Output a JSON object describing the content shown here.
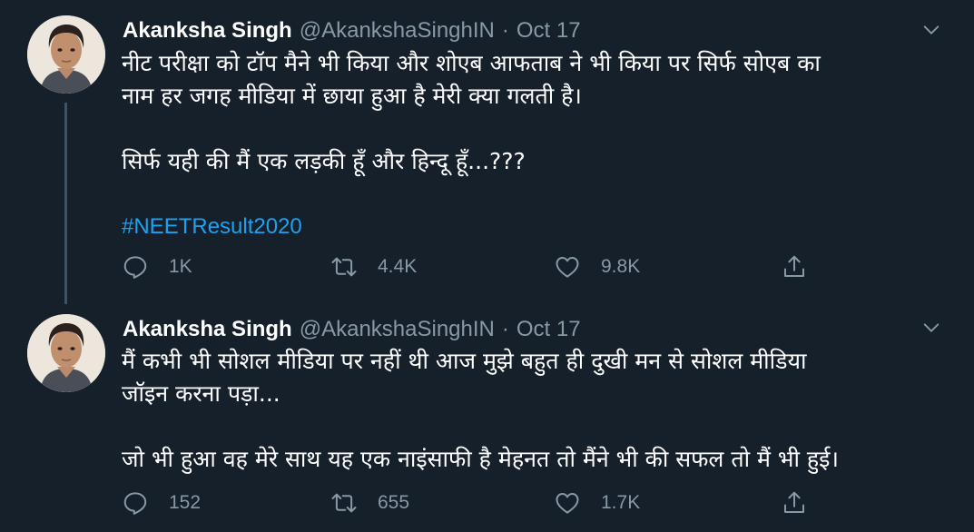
{
  "colors": {
    "background": "#15202b",
    "text": "#ffffff",
    "muted": "#8899a6",
    "hashtag": "#1da1f2",
    "thread_line": "#3d5466"
  },
  "tweets": [
    {
      "author_name": "Akanksha Singh",
      "handle": "@AkankshaSinghIN",
      "separator": "·",
      "date": "Oct 17",
      "lines": [
        "नीट परीक्षा को टॉप मैने भी किया और शोएब आफताब ने भी किया पर सिर्फ सोएब का",
        "नाम हर जगह मीडिया में छाया हुआ है मेरी क्या गलती है।",
        "सिर्फ यही की मैं एक लड़की हूँ और हिन्दू हूँ...???"
      ],
      "hashtag": "#NEETResult2020",
      "replies": "1K",
      "retweets": "4.4K",
      "likes": "9.8K"
    },
    {
      "author_name": "Akanksha Singh",
      "handle": "@AkankshaSinghIN",
      "separator": "·",
      "date": "Oct 17",
      "lines": [
        "मैं कभी भी सोशल मीडिया पर नहीं थी आज मुझे बहुत ही दुखी मन से सोशल मीडिया",
        "जॉइन करना पड़ा...",
        "जो भी हुआ वह मेरे साथ यह एक नाइंसाफी है मेहनत तो मैंने भी की सफल तो मैं भी हुई।"
      ],
      "replies": "152",
      "retweets": "655",
      "likes": "1.7K"
    }
  ],
  "icons": {
    "reply": "reply-icon",
    "retweet": "retweet-icon",
    "like": "heart-icon",
    "share": "share-icon",
    "caret": "chevron-down-icon"
  }
}
